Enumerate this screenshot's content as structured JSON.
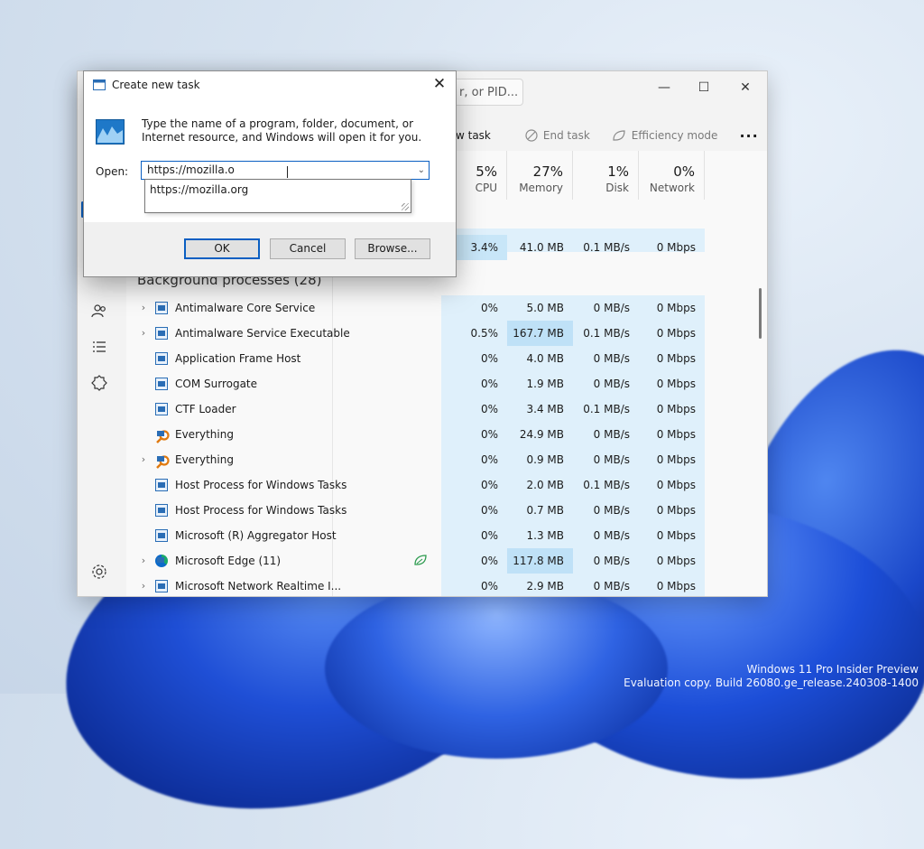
{
  "watermark": {
    "line1": "Windows 11 Pro Insider Preview",
    "line2": "Evaluation copy. Build 26080.ge_release.240308-1400"
  },
  "taskmanager": {
    "search_placeholder": "r, or PID...",
    "window_controls": {
      "minimize": "—",
      "maximize": "☐",
      "close": "✕"
    },
    "toolbar": {
      "new_task": "new task",
      "end_task": "End task",
      "efficiency_mode": "Efficiency mode",
      "more": "···"
    },
    "columns": [
      {
        "pct": "5%",
        "label": "CPU"
      },
      {
        "pct": "27%",
        "label": "Memory"
      },
      {
        "pct": "1%",
        "label": "Disk"
      },
      {
        "pct": "0%",
        "label": "Network"
      }
    ],
    "app_row": {
      "cpu": "3.4%",
      "memory": "41.0 MB",
      "disk": "0.1 MB/s",
      "network": "0 Mbps"
    },
    "section_title": "Background processes (28)",
    "processes": [
      {
        "name": "Antimalware Core Service",
        "expand": true,
        "icon": "app",
        "cpu": "0%",
        "memory": "5.0 MB",
        "disk": "0 MB/s",
        "network": "0 Mbps",
        "mem_hi": false
      },
      {
        "name": "Antimalware Service Executable",
        "expand": true,
        "icon": "app",
        "cpu": "0.5%",
        "memory": "167.7 MB",
        "disk": "0.1 MB/s",
        "network": "0 Mbps",
        "mem_hi": true
      },
      {
        "name": "Application Frame Host",
        "expand": false,
        "icon": "app",
        "cpu": "0%",
        "memory": "4.0 MB",
        "disk": "0 MB/s",
        "network": "0 Mbps",
        "mem_hi": false
      },
      {
        "name": "COM Surrogate",
        "expand": false,
        "icon": "app",
        "cpu": "0%",
        "memory": "1.9 MB",
        "disk": "0 MB/s",
        "network": "0 Mbps",
        "mem_hi": false
      },
      {
        "name": "CTF Loader",
        "expand": false,
        "icon": "app",
        "cpu": "0%",
        "memory": "3.4 MB",
        "disk": "0.1 MB/s",
        "network": "0 Mbps",
        "mem_hi": false
      },
      {
        "name": "Everything",
        "expand": false,
        "icon": "search",
        "cpu": "0%",
        "memory": "24.9 MB",
        "disk": "0 MB/s",
        "network": "0 Mbps",
        "mem_hi": false
      },
      {
        "name": "Everything",
        "expand": true,
        "icon": "search",
        "cpu": "0%",
        "memory": "0.9 MB",
        "disk": "0 MB/s",
        "network": "0 Mbps",
        "mem_hi": false
      },
      {
        "name": "Host Process for Windows Tasks",
        "expand": false,
        "icon": "app",
        "cpu": "0%",
        "memory": "2.0 MB",
        "disk": "0.1 MB/s",
        "network": "0 Mbps",
        "mem_hi": false
      },
      {
        "name": "Host Process for Windows Tasks",
        "expand": false,
        "icon": "app",
        "cpu": "0%",
        "memory": "0.7 MB",
        "disk": "0 MB/s",
        "network": "0 Mbps",
        "mem_hi": false
      },
      {
        "name": "Microsoft (R) Aggregator Host",
        "expand": false,
        "icon": "app",
        "cpu": "0%",
        "memory": "1.3 MB",
        "disk": "0 MB/s",
        "network": "0 Mbps",
        "mem_hi": false
      },
      {
        "name": "Microsoft Edge (11)",
        "expand": true,
        "icon": "edge",
        "cpu": "0%",
        "memory": "117.8 MB",
        "disk": "0 MB/s",
        "network": "0 Mbps",
        "mem_hi": true,
        "status": "leaf"
      },
      {
        "name": "Microsoft Network Realtime I...",
        "expand": true,
        "icon": "app",
        "cpu": "0%",
        "memory": "2.9 MB",
        "disk": "0 MB/s",
        "network": "0 Mbps",
        "mem_hi": false
      }
    ]
  },
  "run_dialog": {
    "title": "Create new task",
    "description": "Type the name of a program, folder, document, or Internet resource, and Windows will open it for you.",
    "open_label": "Open:",
    "open_value": "https://mozilla.o",
    "suggestion": "https://mozilla.org",
    "ok": "OK",
    "cancel": "Cancel",
    "browse": "Browse..."
  }
}
